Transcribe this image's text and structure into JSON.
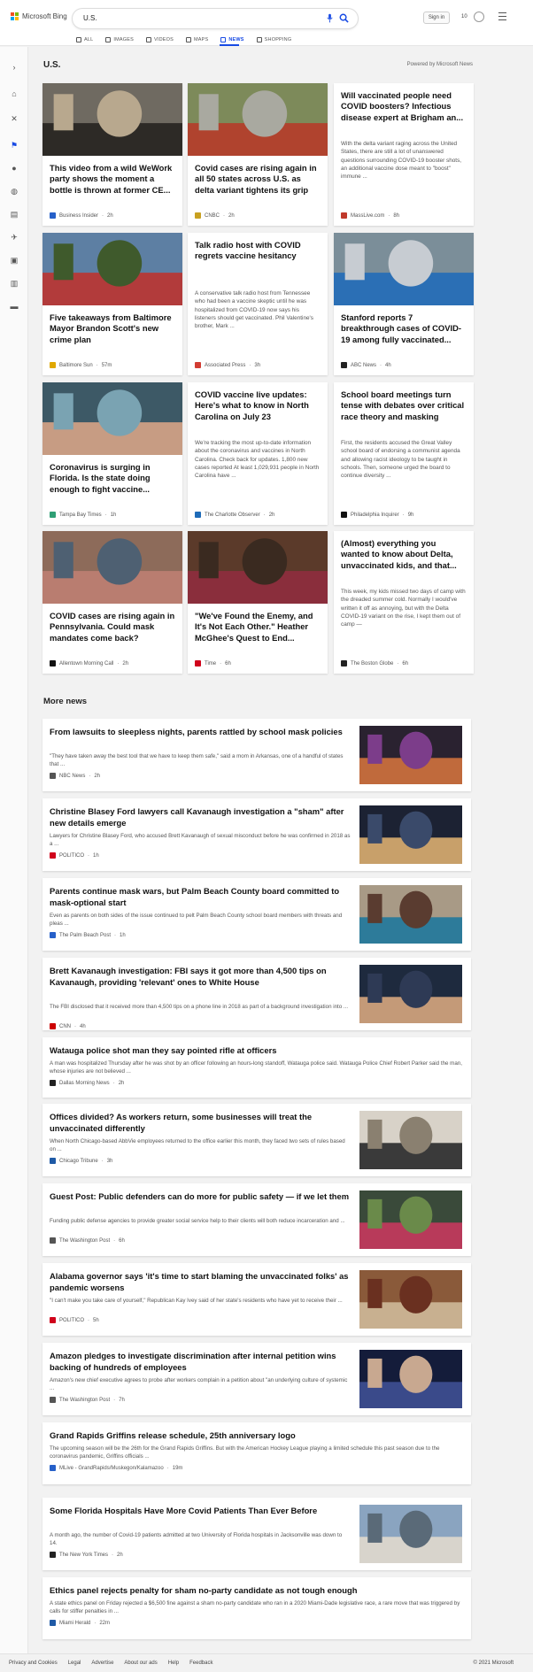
{
  "header": {
    "brand": "Microsoft Bing",
    "query": "U.S.",
    "sign_in": "Sign in",
    "rewards_points": "10",
    "tabs": [
      {
        "label": "ALL",
        "icon": "search-icon"
      },
      {
        "label": "IMAGES",
        "icon": "images-icon"
      },
      {
        "label": "VIDEOS",
        "icon": "videos-icon"
      },
      {
        "label": "MAPS",
        "icon": "maps-icon"
      },
      {
        "label": "NEWS",
        "icon": "news-icon",
        "active": true
      },
      {
        "label": "SHOPPING",
        "icon": "shopping-icon"
      }
    ]
  },
  "rail": [
    "expand-icon",
    "home-icon",
    "tools-icon",
    "flag-icon",
    "location-icon",
    "globe-icon",
    "briefcase-icon",
    "science-icon",
    "entertainment-icon",
    "sports-icon",
    "money-icon"
  ],
  "section_title": "U.S.",
  "powered_by": "Powered by Microsoft News",
  "cards": [
    {
      "title": "This video from a wild WeWork party shows the moment a bottle is thrown at former CE...",
      "snippet": "",
      "source": "Business Insider",
      "time": "2h",
      "has_image": true,
      "img_colors": [
        "#6f6a61",
        "#2d2a26",
        "#b8a88e"
      ],
      "src_color": "#2660c9"
    },
    {
      "title": "Covid cases are rising again in all 50 states across U.S. as delta variant tightens its grip",
      "snippet": "",
      "source": "CNBC",
      "time": "2h",
      "has_image": true,
      "img_colors": [
        "#7d8a5a",
        "#b0432e",
        "#a9a9a0"
      ],
      "src_color": "#c8a020"
    },
    {
      "title": "Will vaccinated people need COVID boosters? Infectious disease expert at Brigham an...",
      "snippet": "With the delta variant raging across the United States, there are still a lot of unanswered questions surrounding COVID-19 booster shots, an additional vaccine dose meant to \"boost\" immune ...",
      "source": "MassLive.com",
      "time": "8h",
      "has_image": false,
      "src_color": "#c0392b"
    },
    {
      "title": "Five takeaways from Baltimore Mayor Brandon Scott's new crime plan",
      "snippet": "",
      "source": "Baltimore Sun",
      "time": "57m",
      "has_image": true,
      "img_colors": [
        "#5d7fa3",
        "#b23b3b",
        "#3f5a2c"
      ],
      "src_color": "#e0a800"
    },
    {
      "title": "Talk radio host with COVID regrets vaccine hesitancy",
      "snippet": "A conservative talk radio host from Tennessee who had been a vaccine skeptic until he was hospitalized from COVID-19 now says his listeners should get vaccinated. Phil Valentine's brother, Mark ...",
      "source": "Associated Press",
      "time": "3h",
      "has_image": false,
      "src_color": "#d23c32"
    },
    {
      "title": "Stanford reports 7 breakthrough cases of COVID-19 among fully vaccinated...",
      "snippet": "",
      "source": "ABC News",
      "time": "4h",
      "has_image": true,
      "img_colors": [
        "#7b8e99",
        "#2b6fb5",
        "#c7ccd2"
      ],
      "src_color": "#222222"
    },
    {
      "title": "Coronavirus is surging in Florida. Is the state doing enough to fight vaccine...",
      "snippet": "",
      "source": "Tampa Bay Times",
      "time": "1h",
      "has_image": true,
      "img_colors": [
        "#3d5966",
        "#c79c83",
        "#7aa3b2"
      ],
      "src_color": "#2f9f75"
    },
    {
      "title": "COVID vaccine live updates: Here's what to know in North Carolina on July 23",
      "snippet": "We're tracking the most up-to-date information about the coronavirus and vaccines in North Carolina. Check back for updates. 1,800 new cases reported At least 1,029,931 people in North Carolina have ...",
      "source": "The Charlotte Observer",
      "time": "2h",
      "has_image": false,
      "src_color": "#1e6bb8"
    },
    {
      "title": "School board meetings turn tense with debates over critical race theory and masking",
      "snippet": "First, the residents accused the Great Valley school board of endorsing a communist agenda and allowing racist ideology to be taught in schools. Then, someone urged the board to continue diversity ...",
      "source": "Philadelphia Inquirer",
      "time": "9h",
      "has_image": false,
      "src_color": "#111111"
    },
    {
      "title": "COVID cases are rising again in Pennsylvania. Could mask mandates come back?",
      "snippet": "",
      "source": "Allentown Morning Call",
      "time": "2h",
      "has_image": true,
      "img_colors": [
        "#8d6b5a",
        "#b97d70",
        "#4e6072"
      ],
      "src_color": "#111111"
    },
    {
      "title": "\"We've Found the Enemy, and It's Not Each Other.\" Heather McGhee's Quest to End...",
      "snippet": "",
      "source": "Time",
      "time": "6h",
      "has_image": true,
      "img_colors": [
        "#5b3a2a",
        "#8a2e3c",
        "#3a2a20"
      ],
      "src_color": "#d0021b"
    },
    {
      "title": "(Almost) everything you wanted to know about Delta, unvaccinated kids, and that...",
      "snippet": "This week, my kids missed two days of camp with the dreaded summer cold. Normally I would've written it off as annoying, but with the Delta COVID-19 variant on the rise, I kept them out of camp —",
      "source": "The Boston Globe",
      "time": "6h",
      "has_image": false,
      "src_color": "#222222"
    }
  ],
  "more_news_title": "More news",
  "more_news": [
    {
      "title": "From lawsuits to sleepless nights, parents rattled by school mask policies",
      "snippet": "\"They have taken away the best tool that we have to keep them safe,\" said a mom in Arkansas, one of a handful of states that ...",
      "source": "NBC News",
      "time": "2h",
      "has_image": true,
      "img_colors": [
        "#2a2230",
        "#c06a3c",
        "#7c3d8a"
      ],
      "src_color": "#555555"
    },
    {
      "title": "Christine Blasey Ford lawyers call Kavanaugh investigation a \"sham\" after new details emerge",
      "snippet": "Lawyers for Christine Blasey Ford, who accused Brett Kavanaugh of sexual misconduct before he was confirmed in 2018 as a ...",
      "source": "POLITICO",
      "time": "1h",
      "has_image": true,
      "img_colors": [
        "#1c2233",
        "#c8a06a",
        "#3a4a6a"
      ],
      "src_color": "#d0021b"
    },
    {
      "title": "Parents continue mask wars, but Palm Beach County board committed to mask-optional start",
      "snippet": "Even as parents on both sides of the issue continued to pelt Palm Beach County school board members with threats and pleas ...",
      "source": "The Palm Beach Post",
      "time": "1h",
      "has_image": true,
      "img_colors": [
        "#a89a86",
        "#2d7b9a",
        "#5a3c30"
      ],
      "src_color": "#2660c9"
    },
    {
      "title": "Brett Kavanaugh investigation: FBI says it got more than 4,500 tips on Kavanaugh, providing 'relevant' ones to White House",
      "snippet": "The FBI disclosed that it received more than 4,500 tips on a phone line in 2018 as part of a background investigation into ...",
      "source": "CNN",
      "time": "4h",
      "has_image": true,
      "img_colors": [
        "#1e2a3e",
        "#c49a78",
        "#2e3a55"
      ],
      "src_color": "#cc0000"
    },
    {
      "title": "Watauga police shot man they say pointed rifle at officers",
      "snippet": "A man was hospitalized Thursday after he was shot by an officer following an hours-long standoff, Watauga police said. Watauga Police Chief Robert Parker said the man, whose injuries are not believed ...",
      "source": "Dallas Morning News",
      "time": "2h",
      "has_image": false,
      "src_color": "#222222"
    },
    {
      "title": "Offices divided? As workers return, some businesses will treat the unvaccinated differently",
      "snippet": "When North Chicago-based AbbVie employees returned to the office earlier this month, they faced two sets of rules based on ...",
      "source": "Chicago Tribune",
      "time": "3h",
      "has_image": true,
      "img_colors": [
        "#d8d2c8",
        "#3a3a3a",
        "#8a8070"
      ],
      "src_color": "#1f5aa6"
    },
    {
      "title": "Guest Post: Public defenders can do more for public safety — if we let them",
      "snippet": "Funding public defense agencies to provide greater social service help to their clients will both reduce incarceration and ...",
      "source": "The Washington Post",
      "time": "6h",
      "has_image": true,
      "img_colors": [
        "#3a4a3a",
        "#b83a5a",
        "#6a8a4a"
      ],
      "src_color": "#555555"
    },
    {
      "title": "Alabama governor says 'it's time to start blaming the unvaccinated folks' as pandemic worsens",
      "snippet": "\"I can't make you take care of yourself,\" Republican Kay Ivey said of her state's residents who have yet to receive their ...",
      "source": "POLITICO",
      "time": "5h",
      "has_image": true,
      "img_colors": [
        "#8a5a3a",
        "#c8b090",
        "#6a3020"
      ],
      "src_color": "#d0021b"
    },
    {
      "title": "Amazon pledges to investigate discrimination after internal petition wins backing of hundreds of employees",
      "snippet": "Amazon's new chief executive agrees to probe after workers complain in a petition about \"an underlying culture of systemic ...",
      "source": "The Washington Post",
      "time": "7h",
      "has_image": true,
      "img_colors": [
        "#141c3a",
        "#3a4a8a",
        "#c8a890"
      ],
      "src_color": "#555555"
    },
    {
      "title": "Grand Rapids Griffins release schedule, 25th anniversary logo",
      "snippet": "The upcoming season will be the 26th for the Grand Rapids Griffins. But with the American Hockey League playing a limited schedule this past season due to the coronavirus pandemic, Griffins officials ...",
      "source": "MLive - GrandRapids/Muskegon/Kalamazoo",
      "time": "19m",
      "has_image": false,
      "src_color": "#2660c9"
    },
    {
      "title": "Some Florida Hospitals Have More Covid Patients Than Ever Before",
      "snippet": "A month ago, the number of Covid-19 patients admitted at two University of Florida hospitals in Jacksonville was down to 14.",
      "source": "The New York Times",
      "time": "2h",
      "has_image": true,
      "img_colors": [
        "#8aa4c0",
        "#d8d4cc",
        "#5a6a78"
      ],
      "src_color": "#222222"
    },
    {
      "title": "Ethics panel rejects penalty for sham no-party candidate as not tough enough",
      "snippet": "A state ethics panel on Friday rejected a $6,500 fine against a sham no-party candidate who ran in a 2020 Miami-Dade legislative race, a rare move that was triggered by calls for stiffer penalties in ...",
      "source": "Miami Herald",
      "time": "22m",
      "has_image": false,
      "src_color": "#1f5aa6"
    }
  ],
  "footer": {
    "links": [
      "Privacy and Cookies",
      "Legal",
      "Advertise",
      "About our ads",
      "Help",
      "Feedback"
    ],
    "copyright": "© 2021 Microsoft"
  },
  "colors": {
    "accent": "#174ae4",
    "background": "#f2f2f2",
    "card": "#ffffff"
  }
}
